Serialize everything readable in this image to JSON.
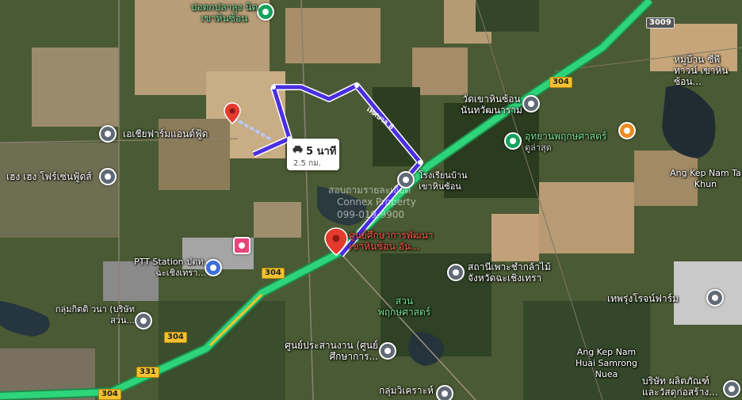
{
  "map": {
    "places": {
      "top_label": "บ่อตกปลาลุง นิดเขาหินซ้อน",
      "asia_farm": "เอเชียฟาร์มแอนด์ฟู้ด",
      "heng_heng": "เฮง เฮง โฟร์เซ่นฟู้ดส์",
      "ptt": "PTT Station ปตท. ฉะเชิงเทรา...",
      "kittiwana": "กลุ่มกิตติ วนา (บริษัท สวน...",
      "wat": "วัดเขาหินซ้อน นันทวัฒนาราม",
      "botanic": "อุทยานพฤกษศาสตร์",
      "botanic_sub": "ดูล่าสุด",
      "school": "โรงเรียนบ้าน เขาหินซ้อน",
      "dev_center": "ศูนย์ศึกษาการพัฒนา เขาหินซ้อน อัน...",
      "nursery": "สถานีเพาะชำกล้าไม้ จังหวัดฉะเชิงเทรา",
      "garden": "สวน พฤกษศาสตร์",
      "coord_center": "ศูนย์ประสานงาน (ศูนย์ศึกษาการ...",
      "group_wichak": "กลุ่มวิเคราะห์",
      "village": "หมู่บ้าน ซีพี ทาวน์ เขาหินซ้อน...",
      "ang_kep_ta_khun": "Ang Kep Nam Ta Khun",
      "thepprung": "เทพรุ่งโรจน์ฟาร์ม",
      "ang_kep_huai": "Ang Kep Nam Huai Samrong Nuea",
      "company": "บริษัท ผลิตภัณฑ์ และวัสดุก่อสร้าง..."
    },
    "road_shields": {
      "r3009": "3009",
      "r304a": "304",
      "r304b": "304",
      "r304c": "304",
      "r331": "331",
      "r304d": "304"
    },
    "road_name": "เทศบาล 8",
    "route": {
      "time": "5 นาที",
      "distance": "2.5 กม."
    },
    "watermark": {
      "line1": "สอบถามรายละเอียด",
      "line2": "Connex Property",
      "line3": "099-019-9900"
    },
    "colors": {
      "route": "#4a2fe0",
      "highway": "#2ed47a",
      "pin_red": "#e53b2f"
    }
  }
}
